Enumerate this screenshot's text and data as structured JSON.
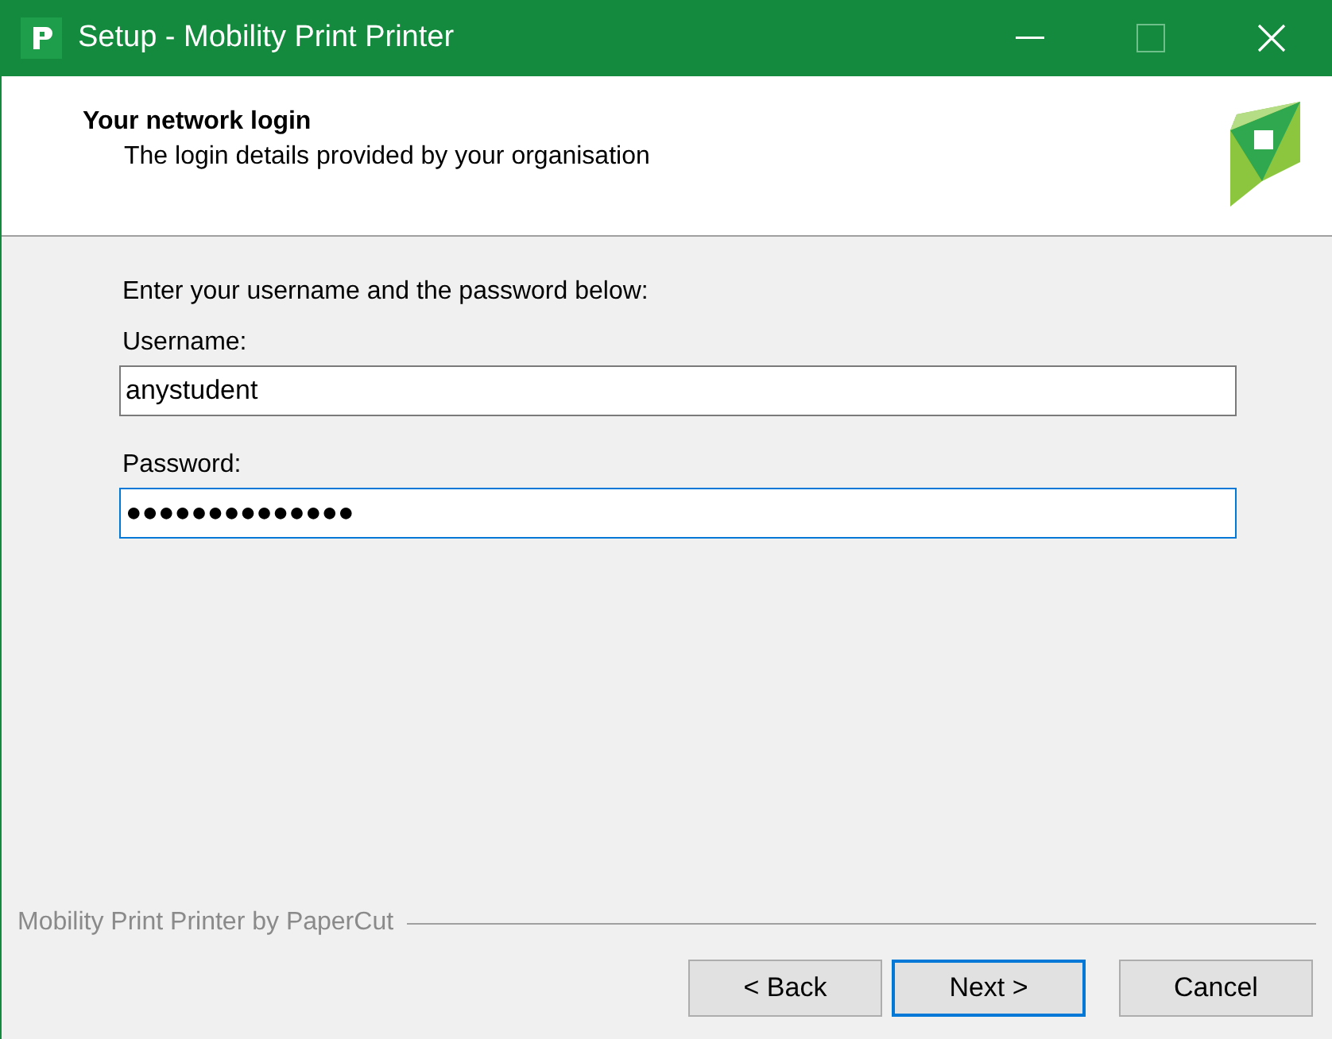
{
  "window": {
    "title": "Setup - Mobility Print Printer"
  },
  "header": {
    "title": "Your network login",
    "subtitle": "The login details provided by your organisation"
  },
  "instruction": "Enter your username and the password below:",
  "fields": [
    {
      "label": "Username:",
      "value": "anystudent",
      "focused": false
    },
    {
      "label": "Password:",
      "value": "●●●●●●●●●●●●●●",
      "focused": true
    }
  ],
  "footer": {
    "brand": "Mobility Print Printer by PaperCut"
  },
  "buttons": [
    {
      "label": "< Back",
      "default": false
    },
    {
      "label": "Next >",
      "default": true
    },
    {
      "label": "Cancel",
      "default": false
    }
  ]
}
